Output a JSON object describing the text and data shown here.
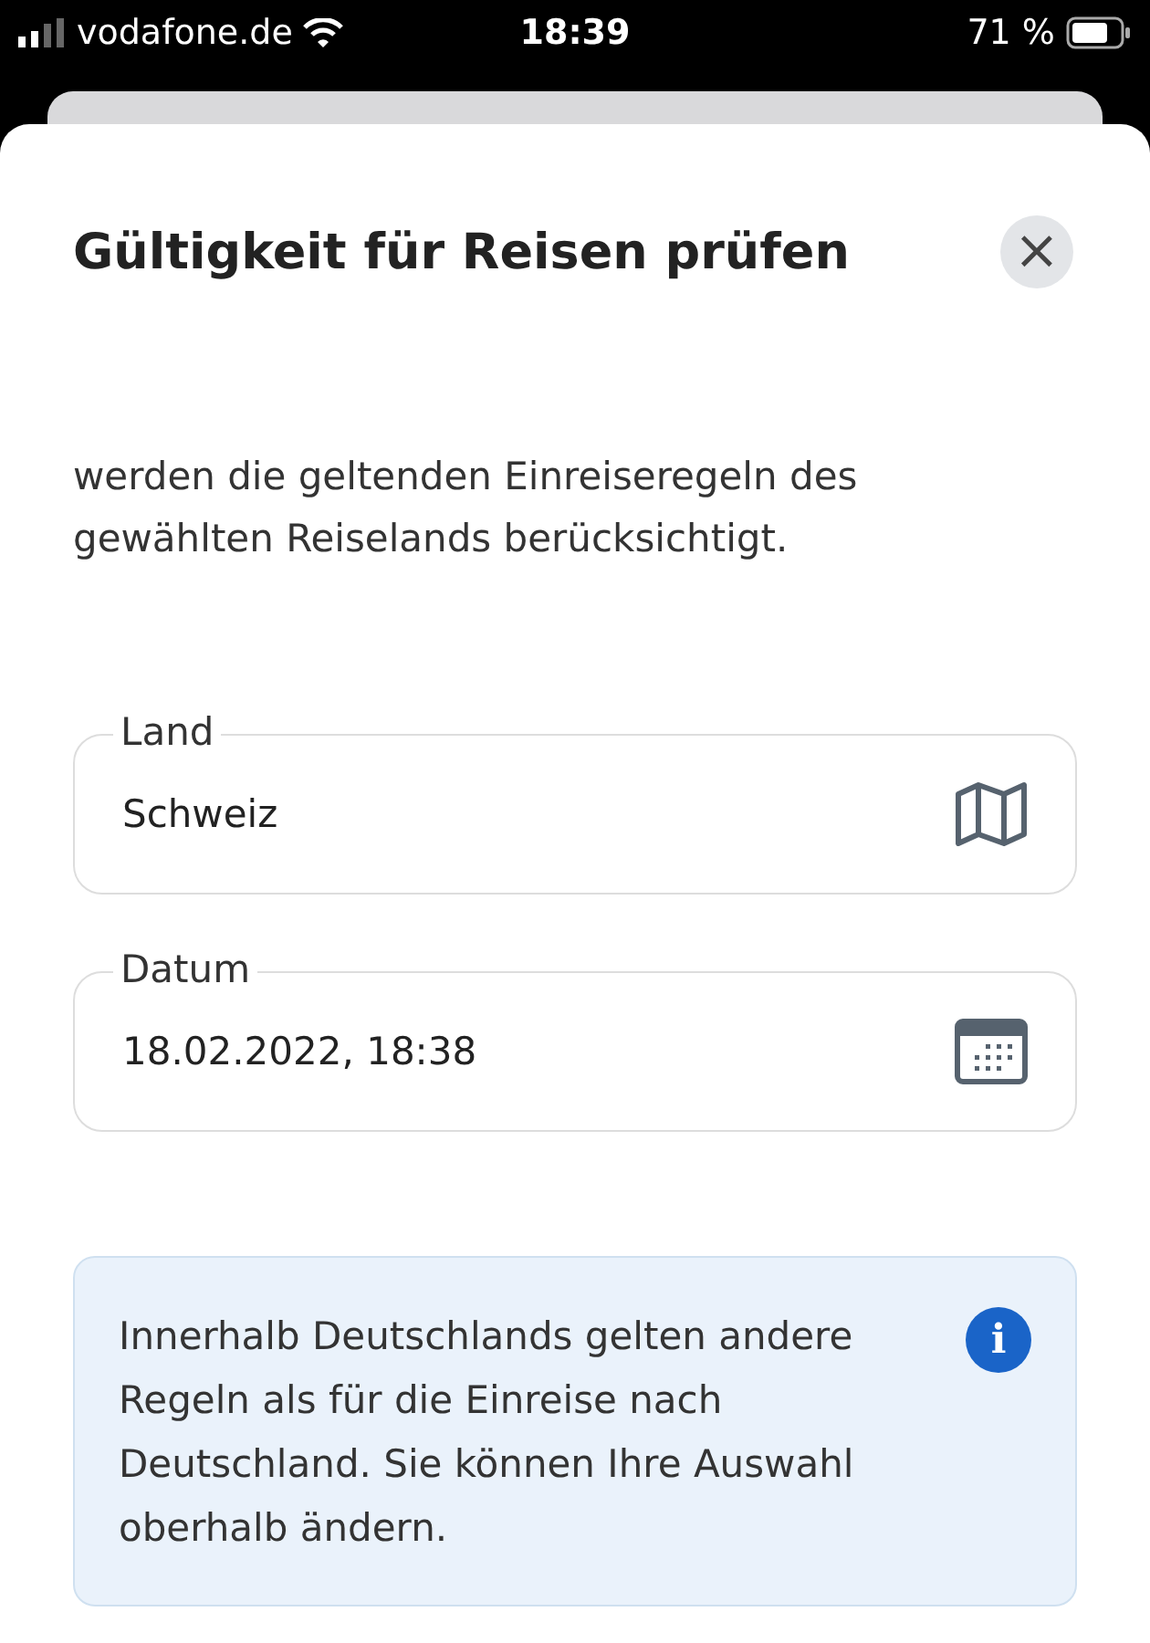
{
  "status_bar": {
    "carrier": "vodafone.de",
    "time": "18:39",
    "battery": "71 %"
  },
  "dialog": {
    "title": "Gültigkeit für Reisen prüfen",
    "close_icon": "×",
    "intro": [
      "werden die geltenden Einreiseregeln des",
      "gewählten Reiselands berücksichtigt."
    ],
    "fields": [
      {
        "label": "Land",
        "value": "Schweiz",
        "kind": "map"
      },
      {
        "label": "Datum",
        "value": "18.02.2022, 18:38",
        "kind": "calendar"
      }
    ],
    "info": {
      "text": "Innerhalb Deutschlands gelten andere Regeln als für die Einreise nach Deutschland. Sie können Ihre Auswahl oberhalb ändern.",
      "icon": "i"
    }
  }
}
